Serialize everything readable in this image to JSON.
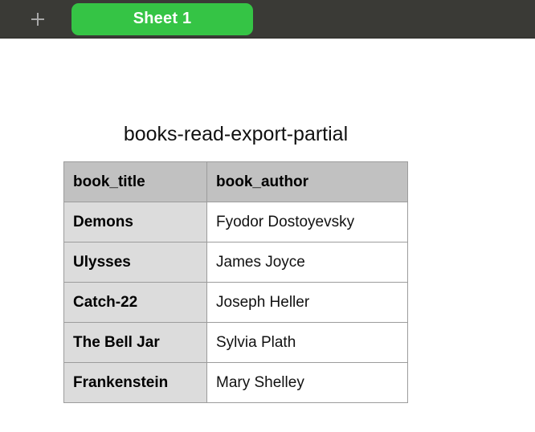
{
  "tabbar": {
    "add_button_icon": "plus-icon",
    "add_button_label": "+",
    "tabs": [
      {
        "label": "Sheet 1",
        "active": true,
        "color": "#35c445"
      }
    ],
    "background_color": "#3a3a36"
  },
  "sheet": {
    "title": "books-read-export-partial",
    "table": {
      "columns": [
        "book_title",
        "book_author"
      ],
      "rows": [
        {
          "book_title": "Demons",
          "book_author": "Fyodor Dostoyevsky"
        },
        {
          "book_title": "Ulysses",
          "book_author": "James Joyce"
        },
        {
          "book_title": "Catch-22",
          "book_author": "Joseph Heller"
        },
        {
          "book_title": "The Bell Jar",
          "book_author": "Sylvia Plath"
        },
        {
          "book_title": "Frankenstein",
          "book_author": "Mary Shelley"
        }
      ],
      "header_background": "#c1c1c1",
      "key_column_background": "#dcdcdc",
      "value_column_background": "#ffffff",
      "border_color": "#9c9c9c"
    }
  }
}
